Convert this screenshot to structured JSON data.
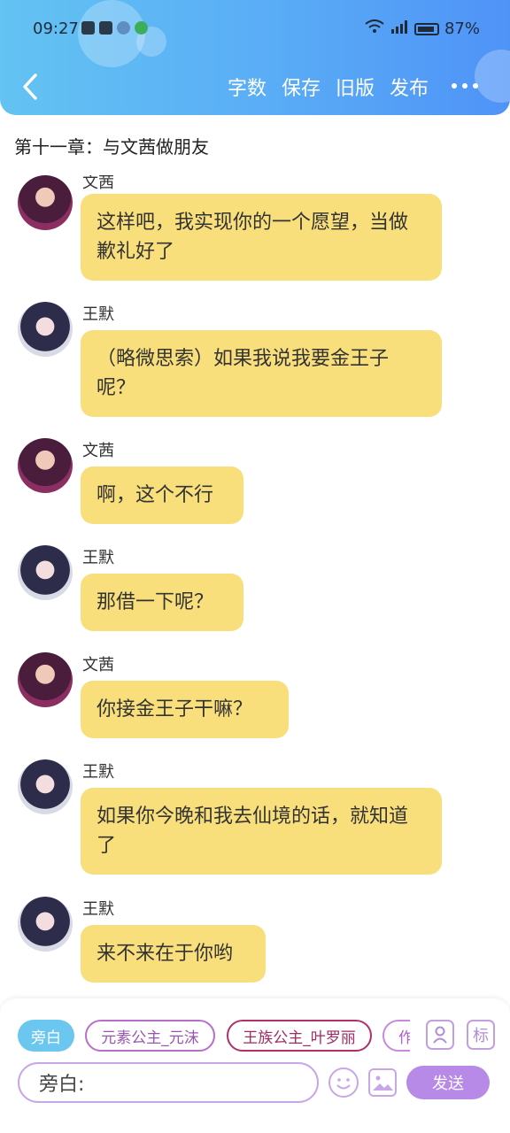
{
  "status_bar": {
    "time": "09:27",
    "battery": "87%"
  },
  "toolbar": {
    "word_count": "字数",
    "save": "保存",
    "old_version": "旧版",
    "publish": "发布"
  },
  "chapter_title": "第十一章：与文茜做朋友",
  "messages": [
    {
      "sender": "文茜",
      "text": "这样吧，我实现你的一个愿望，当做歉礼好了"
    },
    {
      "sender": "王默",
      "text": "（略微思索）如果我说我要金王子呢？"
    },
    {
      "sender": "文茜",
      "text": "啊，这个不行"
    },
    {
      "sender": "王默",
      "text": "那借一下呢？"
    },
    {
      "sender": "文茜",
      "text": "你接金王子干嘛？"
    },
    {
      "sender": "王默",
      "text": "如果你今晚和我去仙境的话，就知道了"
    },
    {
      "sender": "王默",
      "text": "来不来在于你哟"
    }
  ],
  "roles": [
    "旁白",
    "元素公主_元沫",
    "王族公主_叶罗丽",
    "作"
  ],
  "side_icons": {
    "mark": "标"
  },
  "input": {
    "prefix": "旁白:"
  },
  "send_label": "发送",
  "colors": {
    "header_start": "#63c3f2",
    "header_end": "#4f93f7",
    "bubble": "#f8df7c",
    "send": "#b68ae6"
  },
  "icons": [
    "back-icon",
    "more-icon",
    "person-icon",
    "emoji-icon",
    "image-icon"
  ]
}
